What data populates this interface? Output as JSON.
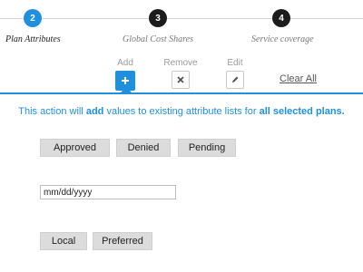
{
  "stepper": {
    "steps": [
      {
        "number": "2",
        "label": "Plan Attributes",
        "state": "active"
      },
      {
        "number": "3",
        "label": "Global Cost Shares",
        "state": "inactive"
      },
      {
        "number": "4",
        "label": "Service coverage",
        "state": "inactive"
      }
    ]
  },
  "toolbar": {
    "add_label": "Add",
    "remove_label": "Remove",
    "edit_label": "Edit",
    "clear_all_label": "Clear All"
  },
  "message": {
    "part1": "This action will ",
    "bold1": "add",
    "part2": " values to existing attribute lists for ",
    "bold2": "all selected plans."
  },
  "status_options": [
    "Approved",
    "Denied",
    "Pending"
  ],
  "date_input": {
    "value": "mm/dd/yyyy"
  },
  "network_options": [
    "Local",
    "Preferred"
  ],
  "colors": {
    "accent": "#1f8fde",
    "step_inactive": "#1c1c1c",
    "chip_bg": "#dcdcdc"
  }
}
